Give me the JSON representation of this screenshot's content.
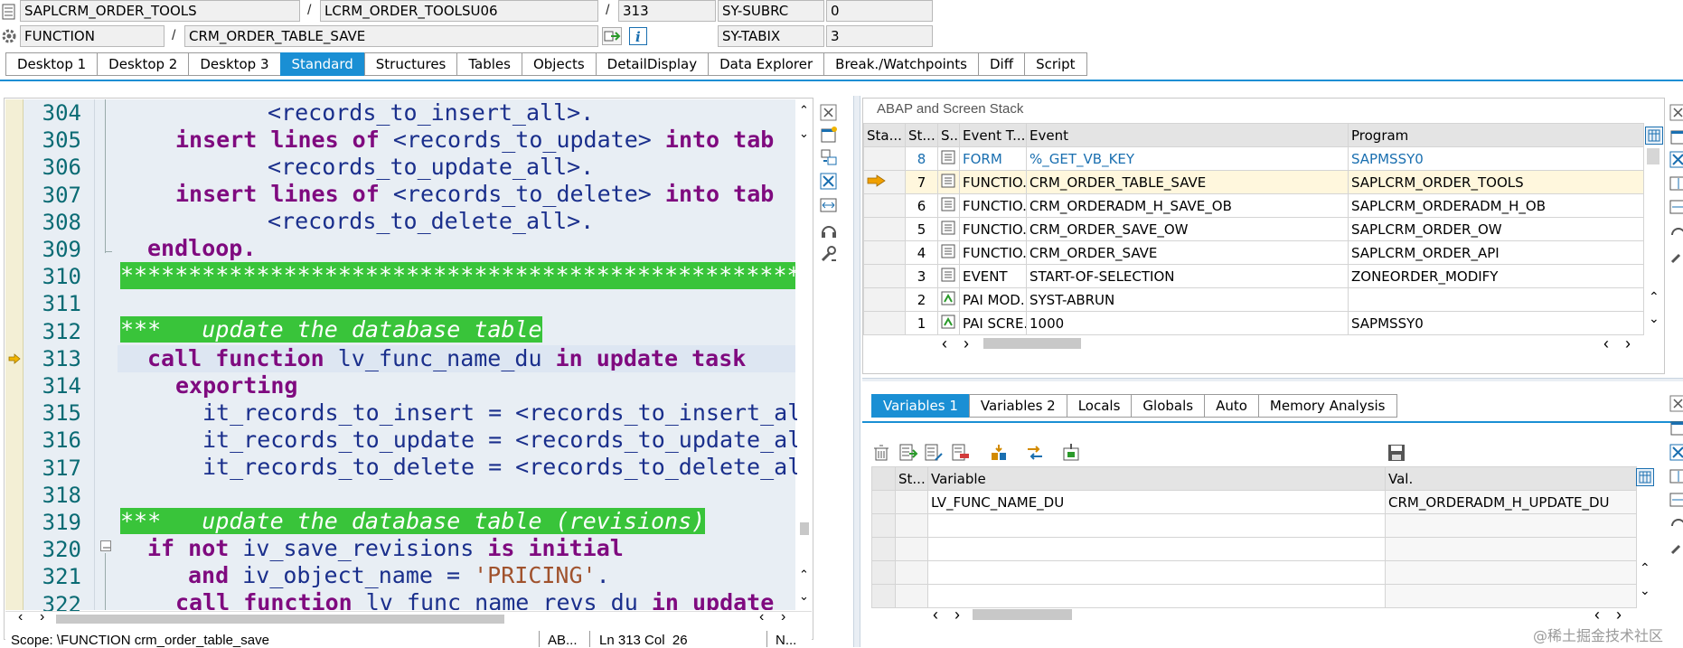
{
  "header": {
    "program": "SAPLCRM_ORDER_TOOLS",
    "include": "LCRM_ORDER_TOOLSU06",
    "line": "313",
    "sysvar1_name": "SY-SUBRC",
    "sysvar1_value": "0",
    "event_type": "FUNCTION",
    "event_name": "CRM_ORDER_TABLE_SAVE",
    "sysvar2_name": "SY-TABIX",
    "sysvar2_value": "3",
    "sep1": "/",
    "sep2": "/",
    "sep3": "/"
  },
  "tabs": [
    "Desktop 1",
    "Desktop 2",
    "Desktop 3",
    "Standard",
    "Structures",
    "Tables",
    "Objects",
    "DetailDisplay",
    "Data Explorer",
    "Break./Watchpoints",
    "Diff",
    "Script"
  ],
  "active_tab": "Standard",
  "code": {
    "lines": [
      {
        "n": "304"
      },
      {
        "n": "305"
      },
      {
        "n": "306"
      },
      {
        "n": "307"
      },
      {
        "n": "308"
      },
      {
        "n": "309"
      },
      {
        "n": "310"
      },
      {
        "n": "311"
      },
      {
        "n": "312"
      },
      {
        "n": "313"
      },
      {
        "n": "314"
      },
      {
        "n": "315"
      },
      {
        "n": "316"
      },
      {
        "n": "317"
      },
      {
        "n": "318"
      },
      {
        "n": "319"
      },
      {
        "n": "320"
      },
      {
        "n": "321"
      },
      {
        "n": "322"
      }
    ],
    "t304": "<records_to_insert_all>.",
    "t305a": "insert lines of",
    "t305b": "<records_to_update>",
    "t305c": "into tab",
    "t306": "<records_to_update_all>.",
    "t307a": "insert lines of",
    "t307b": "<records_to_delete>",
    "t307c": "into tab",
    "t308": "<records_to_delete_all>.",
    "t309": "endloop.",
    "t310": "************************************************************",
    "t312": "***   update the database table",
    "t313a": "call function",
    "t313b": "lv_func_name_du",
    "t313c": "in update task",
    "t314": "exporting",
    "t315": "it_records_to_insert = <records_to_insert_al",
    "t316": "it_records_to_update = <records_to_update_al",
    "t317": "it_records_to_delete = <records_to_delete_al",
    "t319": "***   update the database table (revisions)",
    "t320a": "if not",
    "t320b": "iv_save_revisions",
    "t320c": "is initial",
    "t321a": "and",
    "t321b": "iv_object_name =",
    "t321c": "'PRICING'",
    "t321d": ".",
    "t322a": "call function",
    "t322b": "lv_func_name_revs_du",
    "t322c": "in update"
  },
  "status": {
    "scope": "Scope: \\FUNCTION crm_order_table_save",
    "mode": "AB...",
    "position": "Ln 313 Col  26",
    "extra": "N..."
  },
  "stack": {
    "title": "ABAP and Screen Stack",
    "headers": [
      "Sta...",
      "St...",
      "S...",
      "Event T...",
      "Event",
      "Program"
    ],
    "rows": [
      {
        "level": "8",
        "type": "FORM",
        "event": "%_GET_VB_KEY",
        "program": "SAPMSSY0",
        "current": false,
        "link": true
      },
      {
        "level": "7",
        "type": "FUNCTIO...",
        "event": "CRM_ORDER_TABLE_SAVE",
        "program": "SAPLCRM_ORDER_TOOLS",
        "current": true,
        "link": false
      },
      {
        "level": "6",
        "type": "FUNCTIO...",
        "event": "CRM_ORDERADM_H_SAVE_OB",
        "program": "SAPLCRM_ORDERADM_H_OB",
        "current": false,
        "link": false
      },
      {
        "level": "5",
        "type": "FUNCTIO...",
        "event": "CRM_ORDER_SAVE_OW",
        "program": "SAPLCRM_ORDER_OW",
        "current": false,
        "link": false
      },
      {
        "level": "4",
        "type": "FUNCTIO...",
        "event": "CRM_ORDER_SAVE",
        "program": "SAPLCRM_ORDER_API",
        "current": false,
        "link": false
      },
      {
        "level": "3",
        "type": "EVENT",
        "event": "START-OF-SELECTION",
        "program": "ZONEORDER_MODIFY",
        "current": false,
        "link": false
      },
      {
        "level": "2",
        "type": "PAI MOD...",
        "event": "SYST-ABRUN",
        "program": "",
        "current": false,
        "link": false
      },
      {
        "level": "1",
        "type": "PAI SCRE...",
        "event": "1000",
        "program": "SAPMSSY0",
        "current": false,
        "link": false
      }
    ]
  },
  "vars_tabs": [
    "Variables 1",
    "Variables 2",
    "Locals",
    "Globals",
    "Auto",
    "Memory Analysis"
  ],
  "vars_active": "Variables 1",
  "vars": {
    "headers": [
      "St...",
      "Variable",
      "Val."
    ],
    "rows": [
      {
        "name": "LV_FUNC_NAME_DU",
        "value": "CRM_ORDERADM_H_UPDATE_DU"
      }
    ]
  },
  "watermark": "@稀土掘金技术社区",
  "colors": {
    "accent": "#1a8fd4",
    "code_bg": "#e8eef4",
    "comment_green": "#39c43a",
    "keyword": "#7f0a7f",
    "current_line": "#dde6f2"
  }
}
